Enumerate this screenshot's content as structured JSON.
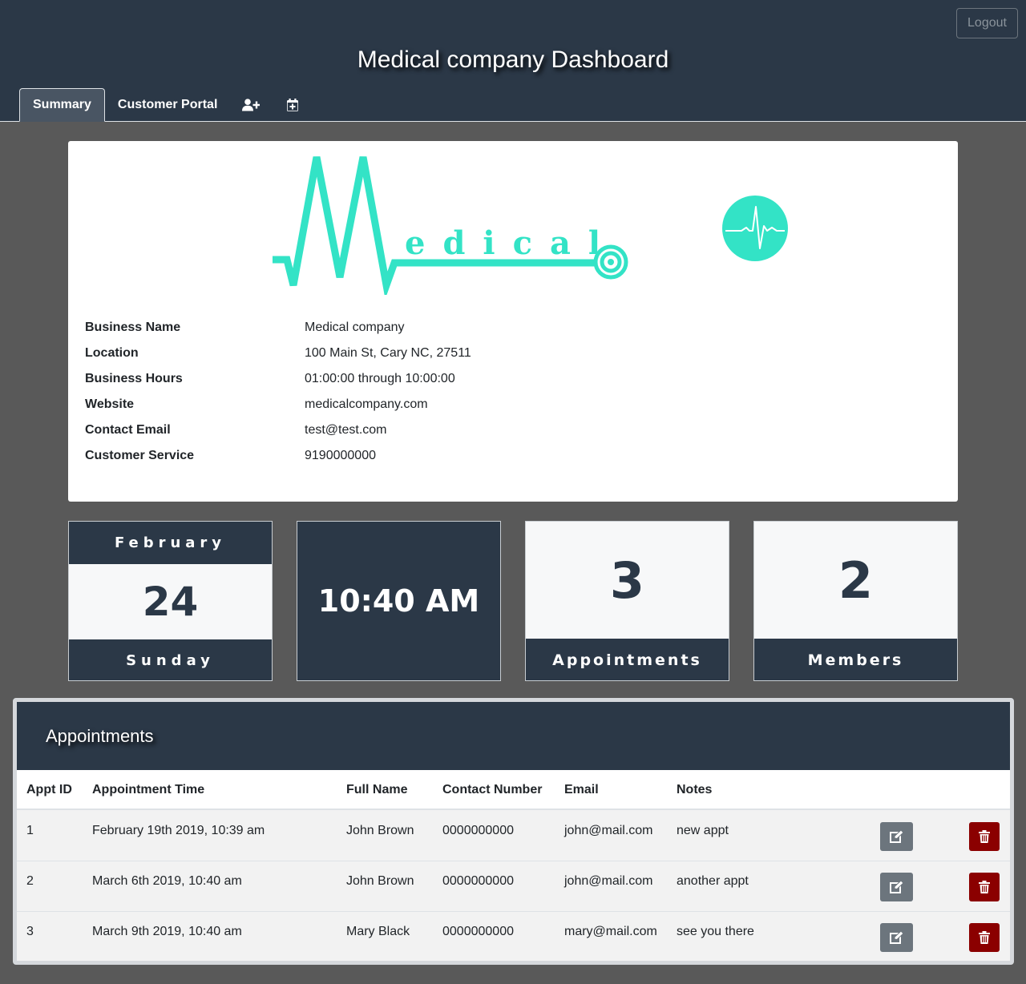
{
  "header": {
    "title": "Medical company Dashboard",
    "logout_label": "Logout",
    "tabs": [
      {
        "label": "Summary"
      },
      {
        "label": "Customer Portal"
      },
      {
        "icon": "user-plus-icon"
      },
      {
        "icon": "calendar-plus-icon"
      }
    ]
  },
  "business": {
    "logo_text": "edical",
    "rows": [
      {
        "label": "Business Name",
        "value": "Medical company"
      },
      {
        "label": "Location",
        "value": "100 Main St, Cary NC, 27511"
      },
      {
        "label": "Business Hours",
        "value": "01:00:00 through 10:00:00"
      },
      {
        "label": "Website",
        "value": "medicalcompany.com"
      },
      {
        "label": "Contact Email",
        "value": "test@test.com"
      },
      {
        "label": "Customer Service",
        "value": "9190000000"
      }
    ]
  },
  "stats": {
    "month": "February",
    "day": "24",
    "weekday": "Sunday",
    "time": "10:40 AM",
    "appointments_count": "3",
    "appointments_label": "Appointments",
    "members_count": "2",
    "members_label": "Members"
  },
  "appointments": {
    "title": "Appointments",
    "columns": [
      "Appt ID",
      "Appointment Time",
      "Full Name",
      "Contact Number",
      "Email",
      "Notes"
    ],
    "rows": [
      {
        "id": "1",
        "time": "February 19th 2019, 10:39 am",
        "name": "John Brown",
        "phone": "0000000000",
        "email": "john@mail.com",
        "notes": "new appt"
      },
      {
        "id": "2",
        "time": "March 6th 2019, 10:40 am",
        "name": "John Brown",
        "phone": "0000000000",
        "email": "john@mail.com",
        "notes": "another appt"
      },
      {
        "id": "3",
        "time": "March 9th 2019, 10:40 am",
        "name": "Mary Black",
        "phone": "0000000000",
        "email": "mary@mail.com",
        "notes": "see you there"
      }
    ]
  },
  "colors": {
    "header_bg": "#2b3847",
    "page_bg": "#595959",
    "brand_teal": "#33e3c6",
    "edit_button": "#6c757d",
    "delete_button": "#8b0000"
  }
}
